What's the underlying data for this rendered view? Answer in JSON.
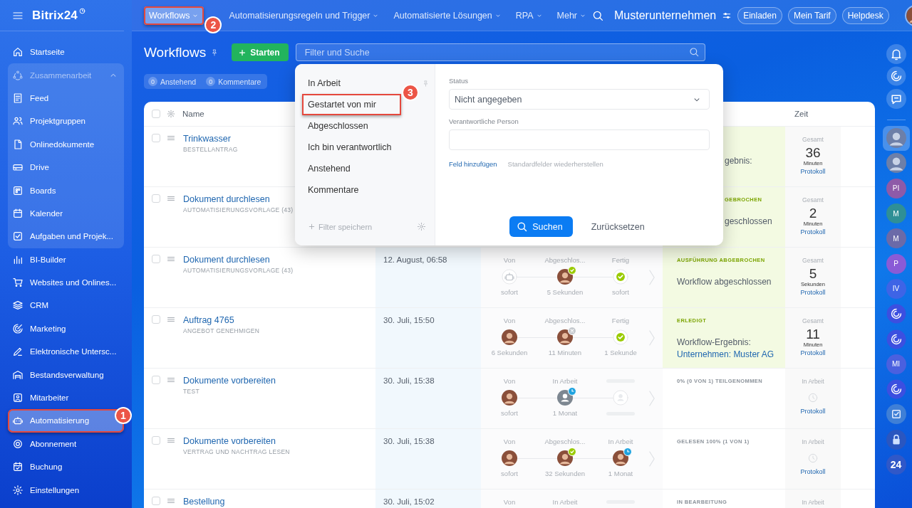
{
  "sidebar": {
    "logo": "Bitrix24",
    "items": [
      {
        "label": "Startseite",
        "selected": false
      },
      {
        "kind": "group",
        "label": "Zusammenarbeit",
        "expanded": true,
        "children": [
          {
            "label": "Feed",
            "selected": false
          },
          {
            "label": "Projektgruppen",
            "selected": false
          },
          {
            "label": "Onlinedokumente",
            "selected": false
          },
          {
            "label": "Drive",
            "selected": false
          },
          {
            "label": "Boards",
            "selected": false
          },
          {
            "label": "Kalender",
            "selected": false
          },
          {
            "label": "Aufgaben und Projek...",
            "selected": false
          }
        ]
      },
      {
        "label": "BI-Builder",
        "selected": false
      },
      {
        "label": "Websites und Onlines...",
        "selected": false
      },
      {
        "label": "CRM",
        "selected": false
      },
      {
        "label": "Marketing",
        "selected": false
      },
      {
        "label": "Elektronische Untersc...",
        "selected": false
      },
      {
        "label": "Bestandsverwaltung",
        "selected": false
      },
      {
        "label": "Mitarbeiter",
        "selected": false
      },
      {
        "label": "Automatisierung",
        "selected": true,
        "callout": "1"
      },
      {
        "label": "Abonnement",
        "selected": false
      },
      {
        "label": "Buchung",
        "selected": false
      },
      {
        "label": "Einstellungen",
        "selected": false
      }
    ]
  },
  "topbar": {
    "nav": [
      {
        "label": "Workflows",
        "selected": true,
        "callout": "2"
      },
      {
        "label": "Automatisierungsregeln und Trigger",
        "selected": false
      },
      {
        "label": "Automatisierte Lösungen",
        "selected": false
      },
      {
        "label": "RPA",
        "selected": false
      },
      {
        "label": "Mehr",
        "selected": false
      }
    ],
    "company": "Musterunternehmen",
    "buttons": [
      "Einladen",
      "Mein Tarif",
      "Helpdesk"
    ]
  },
  "page": {
    "title": "Workflows",
    "start_button": "Starten",
    "search": {
      "placeholder": "Filter und Suche"
    },
    "counters": [
      {
        "count": "0",
        "label": "Anstehend"
      },
      {
        "count": "0",
        "label": "Kommentare"
      }
    ]
  },
  "filter_popup": {
    "presets": [
      {
        "label": "In Arbeit",
        "pinned": true
      },
      {
        "label": "Gestartet von mir",
        "pinned": false,
        "callout": "3"
      },
      {
        "label": "Abgeschlossen",
        "pinned": false
      },
      {
        "label": "Ich bin verantwortlich",
        "pinned": false
      },
      {
        "label": "Anstehend",
        "pinned": false
      },
      {
        "label": "Kommentare",
        "pinned": false
      }
    ],
    "save_filter": "Filter speichern",
    "fields": [
      {
        "kind": "select",
        "label": "Status",
        "value": "Nicht angegeben"
      },
      {
        "kind": "text",
        "label": "Verantwortliche Person"
      }
    ],
    "add_field": "Feld hinzufügen",
    "restore_fields": "Standardfelder wiederherstellen",
    "search_button": "Suchen",
    "reset_button": "Zurücksetzen"
  },
  "table": {
    "columns": [
      "Name",
      "Zeit"
    ],
    "select_all": {
      "checked": false
    },
    "rows": [
      {
        "checked": false,
        "name": "Trinkwasser",
        "template": "BESTELLANTRAG",
        "status": {
          "highlighted": true,
          "text": "gebnis:"
        },
        "time": {
          "caption": "Gesamt",
          "value": "36",
          "unit": "Minuten",
          "link": "Protokoll"
        }
      },
      {
        "checked": false,
        "name": "Dokument durchlesen",
        "template": "AUTOMATISIERUNGSVORLAGE (43)",
        "status": {
          "highlighted": true,
          "label": "GEBROCHEN",
          "text": "geschlossen"
        },
        "time": {
          "caption": "Gesamt",
          "value": "2",
          "unit": "Minuten",
          "link": "Protokoll"
        }
      },
      {
        "checked": false,
        "name": "Dokument durchlesen",
        "template": "AUTOMATISIERUNGSVORLAGE (43)",
        "date": "12. August, 06:58",
        "steps": [
          {
            "label": "Von",
            "kind": "robot",
            "approved": false,
            "declined": false,
            "waiting": false,
            "time": "sofort"
          },
          {
            "label": "Abgeschlos...",
            "kind": "avatar",
            "approved": true,
            "declined": false,
            "waiting": false,
            "time": "5 Sekunden"
          },
          {
            "label": "Fertig",
            "kind": "done",
            "approved": false,
            "declined": false,
            "waiting": false,
            "time": "sofort"
          }
        ],
        "status": {
          "highlighted": true,
          "label": "AUSFÜHRUNG ABGEBROCHEN",
          "text": "Workflow abgeschlossen"
        },
        "time": {
          "caption": "Gesamt",
          "value": "5",
          "unit": "Sekunden",
          "link": "Protokoll"
        }
      },
      {
        "checked": false,
        "name": "Auftrag 4765",
        "template": "ANGEBOT GENEHMIGEN",
        "date": "30. Juli, 15:50",
        "steps": [
          {
            "label": "Von",
            "kind": "avatar",
            "approved": false,
            "declined": false,
            "waiting": false,
            "time": "6 Sekunden"
          },
          {
            "label": "Abgeschlos...",
            "kind": "avatar",
            "approved": false,
            "declined": true,
            "waiting": false,
            "time": "11 Minuten"
          },
          {
            "label": "Fertig",
            "kind": "done",
            "approved": false,
            "declined": false,
            "waiting": false,
            "time": "1 Sekunde"
          }
        ],
        "status": {
          "highlighted": true,
          "label": "ERLEDIGT",
          "text": "Workflow-Ergebnis:",
          "link": "Unternehmen: Muster AG"
        },
        "time": {
          "caption": "Gesamt",
          "value": "11",
          "unit": "Minuten",
          "link": "Protokoll"
        }
      },
      {
        "checked": false,
        "name": "Dokumente vorbereiten",
        "template": "TEST",
        "date": "30. Juli, 15:38",
        "steps": [
          {
            "label": "Von",
            "kind": "avatar",
            "approved": false,
            "declined": false,
            "waiting": false,
            "time": "sofort"
          },
          {
            "label": "In Arbeit",
            "kind": "person",
            "approved": false,
            "declined": false,
            "waiting": true,
            "time": "1 Monat"
          },
          {
            "placeholder": true,
            "kind": "empty",
            "approved": false,
            "declined": false,
            "waiting": false,
            "time_placeholder": true
          }
        ],
        "status": {
          "highlighted": false,
          "label": "0% (0 VON 1) TEILGENOMMEN"
        },
        "time": {
          "caption": "In Arbeit",
          "clock": true,
          "link": "Protokoll"
        }
      },
      {
        "checked": false,
        "name": "Dokumente vorbereiten",
        "template": "VERTRAG UND NACHTRAG LESEN",
        "date": "30. Juli, 15:38",
        "steps": [
          {
            "label": "Von",
            "kind": "avatar",
            "approved": false,
            "declined": false,
            "waiting": false,
            "time": "sofort"
          },
          {
            "label": "Abgeschlos...",
            "kind": "avatar",
            "approved": true,
            "declined": false,
            "waiting": false,
            "time": "32 Sekunden"
          },
          {
            "label": "In Arbeit",
            "kind": "avatar",
            "approved": false,
            "declined": false,
            "waiting": true,
            "time": "1 Monat"
          }
        ],
        "status": {
          "highlighted": false,
          "label": "GELESEN 100% (1 VON 1)"
        },
        "time": {
          "caption": "In Arbeit",
          "clock": true,
          "link": "Protokoll"
        }
      },
      {
        "checked": false,
        "name": "Bestellung",
        "date": "30. Juli, 15:02",
        "steps": [
          {
            "label": "Von"
          },
          {
            "label": "In Arbeit"
          },
          {
            "placeholder": true
          }
        ],
        "status": {
          "highlighted": false,
          "label": "IN BEARBEITUNG"
        },
        "time": {
          "caption": "In Arbeit"
        }
      }
    ]
  },
  "rail": {
    "items": [
      {
        "kind": "bell",
        "selected": false
      },
      {
        "kind": "spiral",
        "selected": false
      },
      {
        "kind": "chat",
        "selected": false
      },
      {
        "kind": "avatar",
        "selected": true
      },
      {
        "kind": "avatar",
        "selected": false
      },
      {
        "kind": "initials",
        "text": "PI",
        "color": "#8e5aa8",
        "selected": false
      },
      {
        "kind": "initials",
        "text": "M",
        "color": "#2f8f96",
        "selected": false
      },
      {
        "kind": "initials",
        "text": "M",
        "color": "#6b6aa8",
        "selected": false
      },
      {
        "kind": "initials",
        "text": "P",
        "color": "#8a5bd6",
        "selected": false
      },
      {
        "kind": "initials",
        "text": "IV",
        "color": "#3e64e6",
        "selected": false
      },
      {
        "kind": "spiral",
        "selected": false
      },
      {
        "kind": "spiral",
        "selected": false
      },
      {
        "kind": "initials",
        "text": "MI",
        "color": "#4a60df",
        "selected": false
      },
      {
        "kind": "spiral",
        "selected": false
      },
      {
        "kind": "task",
        "selected": false
      },
      {
        "kind": "lock",
        "selected": false
      },
      {
        "kind": "logo",
        "text": "24",
        "selected": false
      }
    ]
  }
}
